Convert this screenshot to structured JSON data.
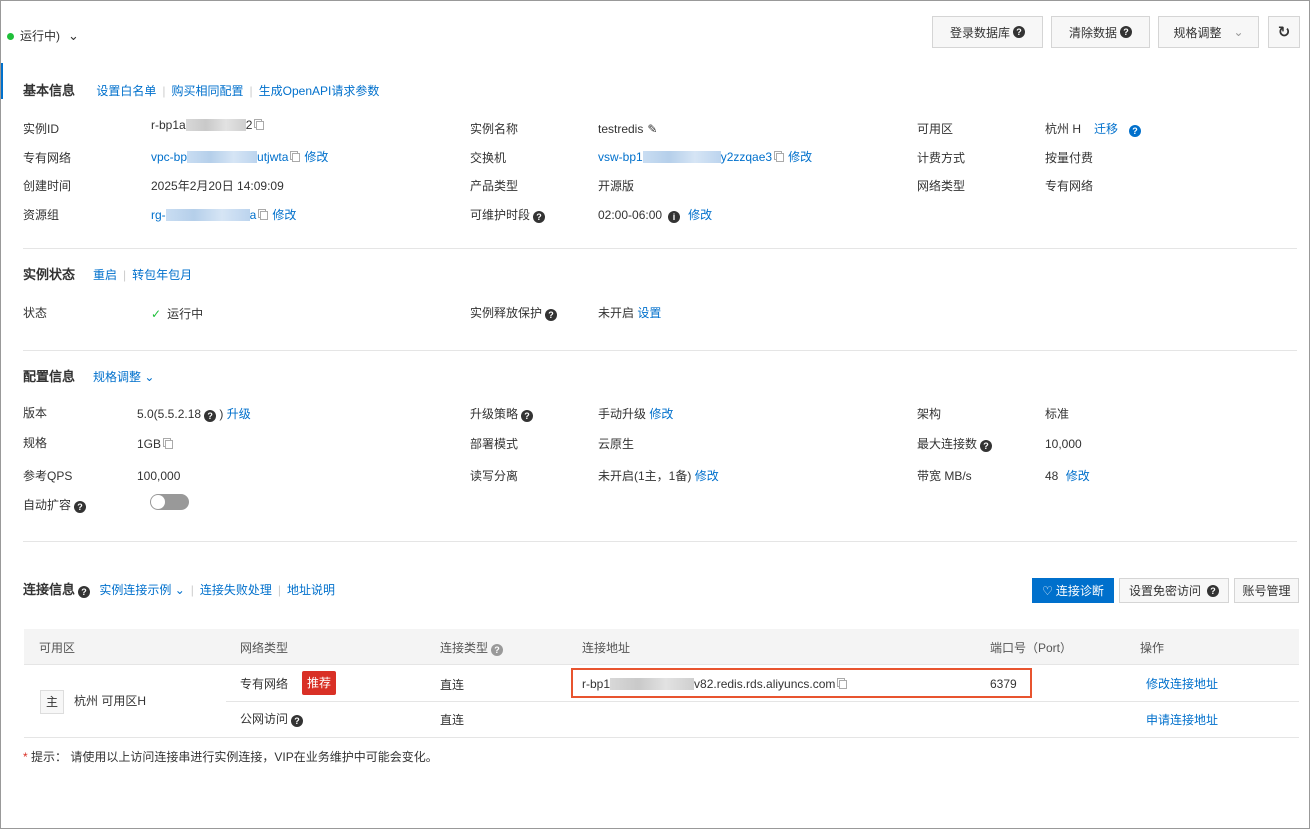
{
  "header": {
    "status": "运行中)",
    "buttons": {
      "login": "登录数据库",
      "clear": "清除数据",
      "resize": "规格调整"
    }
  },
  "basic": {
    "title": "基本信息",
    "links": [
      "设置白名单",
      "购买相同配置",
      "生成OpenAPI请求参数"
    ],
    "instance_id_label": "实例ID",
    "instance_id_pre": "r-bp1a",
    "instance_id_post": "2",
    "vpc_label": "专有网络",
    "vpc_pre": "vpc-bp",
    "vpc_post": "utjwta",
    "modify": "修改",
    "created_label": "创建时间",
    "created": "2025年2月20日 14:09:09",
    "rg_label": "资源组",
    "rg_pre": "rg-",
    "rg_post": "a",
    "name_label": "实例名称",
    "name": "testredis",
    "vsw_label": "交换机",
    "vsw_pre": "vsw-bp1",
    "vsw_post": "y2zzqae3",
    "product_label": "产品类型",
    "product": "开源版",
    "maint_label": "可维护时段",
    "maint": "02:00-06:00",
    "zone_label": "可用区",
    "zone": "杭州 H",
    "migrate": "迁移",
    "billing_label": "计费方式",
    "billing": "按量付费",
    "net_label": "网络类型",
    "net": "专有网络"
  },
  "state": {
    "title": "实例状态",
    "links": [
      "重启",
      "转包年包月"
    ],
    "status_label": "状态",
    "status": "运行中",
    "release_label": "实例释放保护",
    "release": "未开启",
    "set": "设置"
  },
  "config": {
    "title": "配置信息",
    "resize": "规格调整",
    "version_label": "版本",
    "version": "5.0(5.5.2.18",
    "version_close": ")",
    "upgrade": "升级",
    "spec_label": "规格",
    "spec": "1GB",
    "qps_label": "参考QPS",
    "qps": "100,000",
    "autoscale_label": "自动扩容",
    "autoscale_on": false,
    "upgrade_policy_label": "升级策略",
    "upgrade_policy": "手动升级",
    "deploy_label": "部署模式",
    "deploy": "云原生",
    "rw_label": "读写分离",
    "rw": "未开启(1主，1备)",
    "arch_label": "架构",
    "arch": "标准",
    "maxconn_label": "最大连接数",
    "maxconn": "10,000",
    "bw_label": "带宽 MB/s",
    "bw": "48",
    "modify": "修改"
  },
  "conn": {
    "title": "连接信息",
    "links": [
      "实例连接示例",
      "连接失败处理",
      "地址说明"
    ],
    "diag": "连接诊断",
    "nopwd": "设置免密访问",
    "account": "账号管理",
    "columns": [
      "可用区",
      "网络类型",
      "连接类型",
      "连接地址",
      "端口号（Port）",
      "操作"
    ],
    "zone_tag": "主",
    "zone": "杭州 可用区H",
    "rows": [
      {
        "net": "专有网络",
        "badge": "推荐",
        "type": "直连",
        "addr_pre": "r-bp1",
        "addr_post": "v82.redis.rds.aliyuncs.com",
        "port": "6379",
        "action": "修改连接地址"
      },
      {
        "net": "公网访问",
        "type": "直连",
        "action": "申请连接地址"
      }
    ],
    "note_star": "*",
    "note": "提示：  请使用以上访问连接串进行实例连接，VIP在业务维护中可能会变化。"
  }
}
